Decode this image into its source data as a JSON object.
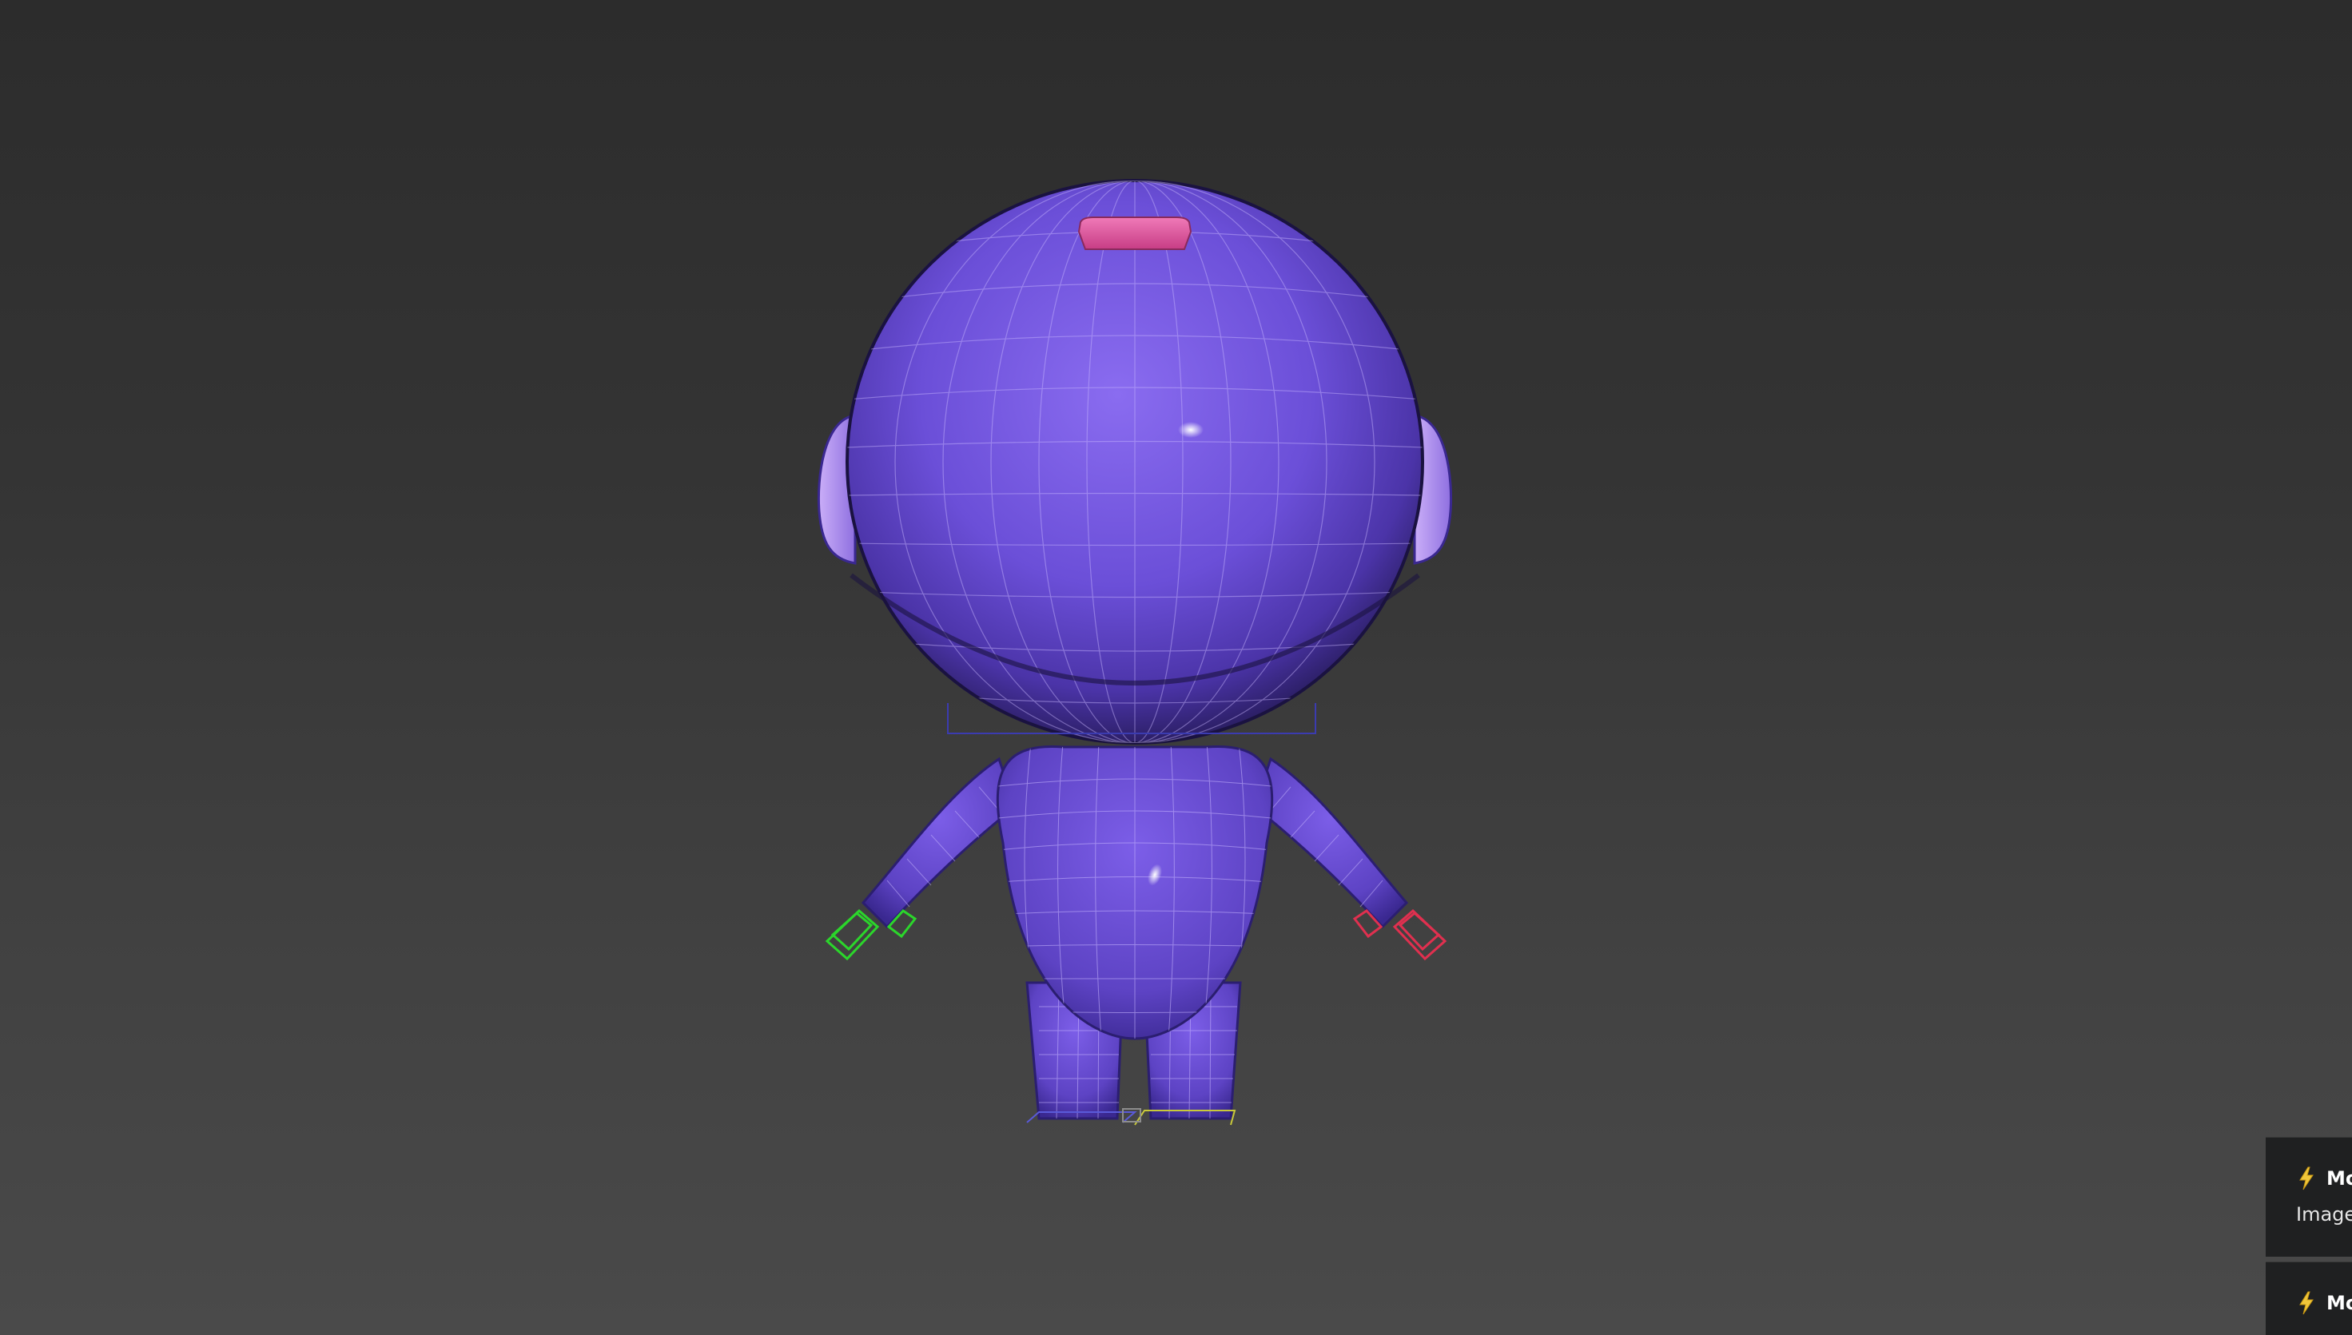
{
  "viewport": {
    "background_top": "#2c2c2c",
    "background_bottom": "#4a4a4a",
    "model": {
      "body_color": "#6a4fd3",
      "head_color": "#7a5ce0",
      "ear_color": "#b294f0",
      "antenna_color": "#e0559d",
      "wire_color": "#c9b8ff",
      "left_hand_gizmo_color": "#2bd62b",
      "right_hand_gizmo_color": "#e0304f",
      "foot_gizmo_color": "#c9c93a"
    }
  },
  "notifications": [
    {
      "icon": "lightning-icon",
      "title": "Mo",
      "message": "Image c"
    },
    {
      "icon": "lightning-icon",
      "title": "Mo",
      "message": ""
    }
  ]
}
